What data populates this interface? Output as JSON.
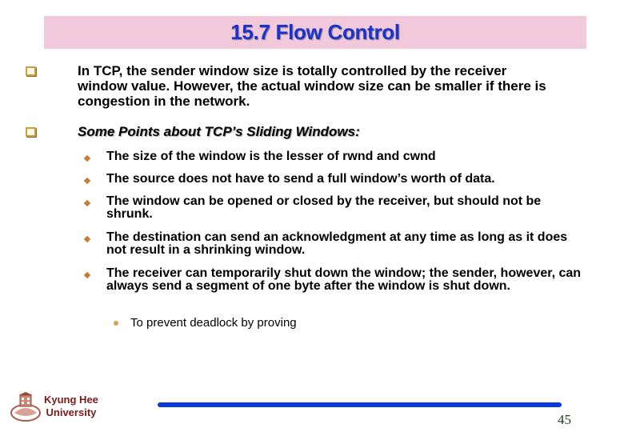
{
  "slide": {
    "title": "15.7 Flow Control",
    "colors": {
      "title_bg": "#f2c9db",
      "title_text": "#1a33c8",
      "footer_bar": "#0a3adb",
      "logo_text": "#7a1a1a"
    },
    "points": [
      {
        "icon": "checkbox-bullet-icon",
        "text": "In TCP, the sender window size is totally controlled by the receiver window value. However, the actual window size can be smaller if there is congestion in the network."
      },
      {
        "icon": "checkbox-bullet-icon",
        "text": "Some Points about TCP’s Sliding Windows:",
        "sub_points": [
          {
            "icon": "diamond-bullet-icon",
            "text": "The size of the window is the lesser of rwnd and cwnd"
          },
          {
            "icon": "diamond-bullet-icon",
            "text": "The source does not have to send a full window’s worth of data."
          },
          {
            "icon": "diamond-bullet-icon",
            "text": "The window can be opened or closed by the receiver, but should not be shrunk."
          },
          {
            "icon": "diamond-bullet-icon",
            "text": "The destination can send an acknowledgment at any time as long as it does not result in a shrinking window."
          },
          {
            "icon": "diamond-bullet-icon",
            "text": "The receiver can temporarily shut down the window; the sender, however, can always send a segment of one byte after the window is shut down.",
            "sub_points": [
              {
                "icon": "dot-bullet-icon",
                "text": "To prevent deadlock by proving"
              }
            ]
          }
        ]
      }
    ]
  },
  "footer": {
    "logo_icon": "university-emblem-icon",
    "institution_line1": "Kyung Hee",
    "institution_line2": "University",
    "page_number": "45"
  }
}
